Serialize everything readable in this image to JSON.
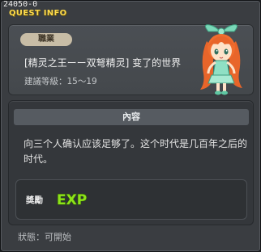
{
  "window": {
    "quest_id": "24050-0",
    "title": "QUEST INFO"
  },
  "info": {
    "job_badge": "職業",
    "quest_name": "[精灵之王ーー双弩精灵] 变了的世界",
    "recommended_level": "建議等級：15～19",
    "npc_portrait_icon": "fairy-npc-portrait"
  },
  "content": {
    "header": "內容",
    "text": "向三个人确认应该足够了。这个时代是几百年之后的时代。",
    "reward_label": "獎勵",
    "reward_icon": "exp-icon",
    "reward_text": "EXP"
  },
  "status": {
    "text": "狀態：可開始"
  },
  "colors": {
    "title": "#ffdc4a",
    "exp_green": "#8de21a",
    "badge_bg": "#c8bda6"
  }
}
